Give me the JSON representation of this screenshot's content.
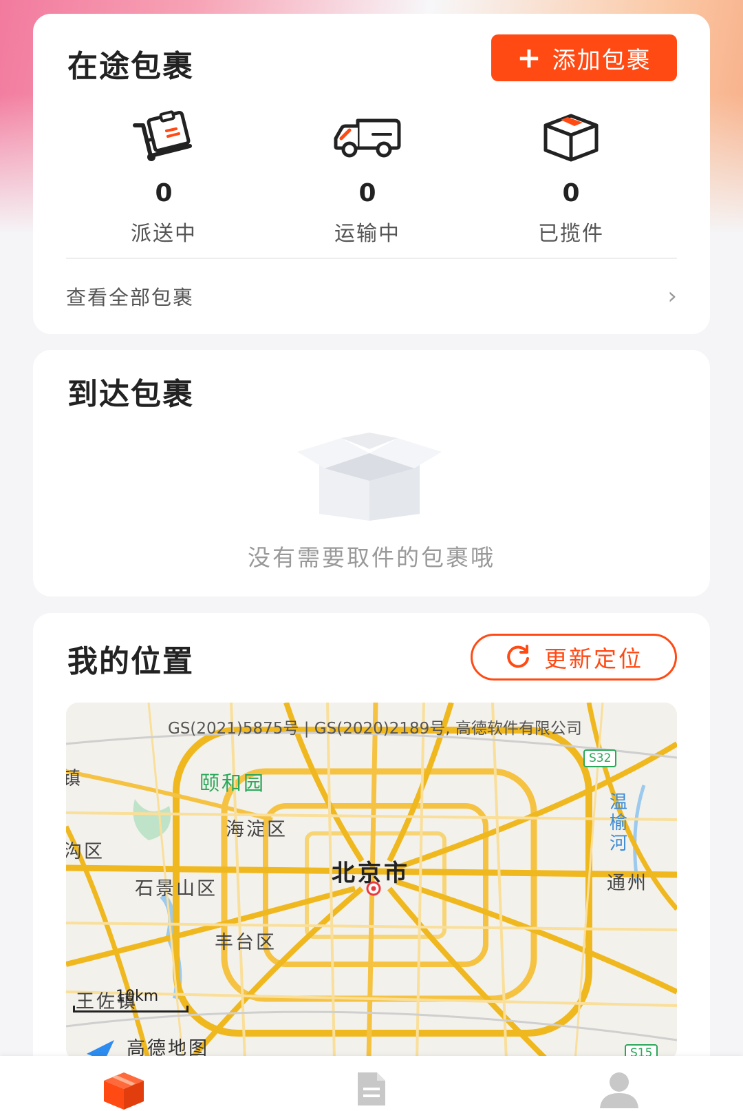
{
  "transit": {
    "title": "在途包裹",
    "add_button": "添加包裹",
    "add_icon": "+",
    "stats": [
      {
        "count": "0",
        "label": "派送中",
        "icon": "hand-truck-icon"
      },
      {
        "count": "0",
        "label": "运输中",
        "icon": "truck-icon"
      },
      {
        "count": "0",
        "label": "已揽件",
        "icon": "box-icon"
      }
    ],
    "view_all": "查看全部包裹",
    "chevron": "›"
  },
  "arrived": {
    "title": "到达包裹",
    "empty_text": "没有需要取件的包裹哦"
  },
  "location": {
    "title": "我的位置",
    "update_button": "更新定位",
    "map": {
      "copyright": "GS(2021)5875号 | GS(2020)2189号, 高德软件有限公司",
      "city": "北京市",
      "labels": {
        "zhen": "镇",
        "yiheyuan": "颐和园",
        "haidian": "海淀区",
        "gouqu": "沟区",
        "shijingshan": "石景山区",
        "fengtai": "丰台区",
        "wangzuo": "王佐镇",
        "tongzhou": "通州",
        "river": "温榆河",
        "brand": "高德地图"
      },
      "road_signs": [
        "S32",
        "S15"
      ],
      "scale": "10km"
    }
  },
  "tabbar": {
    "tabs": [
      "parcel-tab",
      "orders-tab",
      "profile-tab"
    ],
    "active_color": "#ff4a14",
    "inactive_color": "#c8c8c8"
  },
  "colors": {
    "accent": "#ff4a14"
  }
}
